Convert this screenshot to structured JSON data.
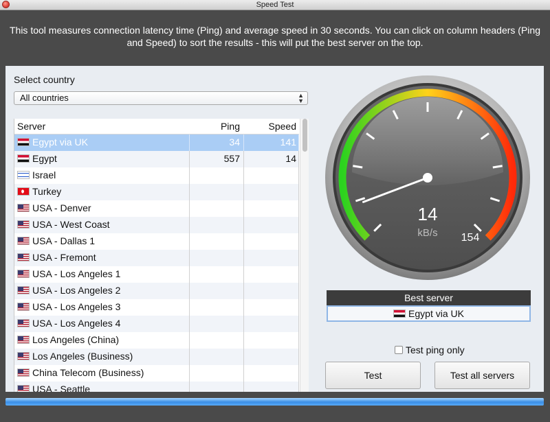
{
  "window": {
    "title": "Speed Test"
  },
  "description": "This tool measures connection latency time (Ping) and average speed in 30 seconds. You can click on column headers (Ping and Speed) to sort the results - this will put the best server on the top.",
  "country": {
    "label": "Select country",
    "selected": "All countries"
  },
  "table": {
    "headers": {
      "server": "Server",
      "ping": "Ping",
      "speed": "Speed"
    },
    "rows": [
      {
        "server": "Egypt via UK",
        "flag": "eg",
        "ping": "34",
        "speed": "141",
        "selected": true
      },
      {
        "server": "Egypt",
        "flag": "eg",
        "ping": "557",
        "speed": "14"
      },
      {
        "server": "Israel",
        "flag": "il",
        "ping": "",
        "speed": ""
      },
      {
        "server": "Turkey",
        "flag": "tr",
        "ping": "",
        "speed": ""
      },
      {
        "server": "USA - Denver",
        "flag": "us",
        "ping": "",
        "speed": ""
      },
      {
        "server": "USA - West Coast",
        "flag": "us",
        "ping": "",
        "speed": ""
      },
      {
        "server": "USA - Dallas 1",
        "flag": "us",
        "ping": "",
        "speed": ""
      },
      {
        "server": "USA - Fremont",
        "flag": "us",
        "ping": "",
        "speed": ""
      },
      {
        "server": "USA - Los Angeles 1",
        "flag": "us",
        "ping": "",
        "speed": ""
      },
      {
        "server": "USA - Los Angeles 2",
        "flag": "us",
        "ping": "",
        "speed": ""
      },
      {
        "server": "USA - Los Angeles 3",
        "flag": "us",
        "ping": "",
        "speed": ""
      },
      {
        "server": "USA - Los Angeles 4",
        "flag": "us",
        "ping": "",
        "speed": ""
      },
      {
        "server": "Los Angeles (China)",
        "flag": "us",
        "ping": "",
        "speed": ""
      },
      {
        "server": "Los Angeles (Business)",
        "flag": "us",
        "ping": "",
        "speed": ""
      },
      {
        "server": "China Telecom (Business)",
        "flag": "us",
        "ping": "",
        "speed": ""
      },
      {
        "server": "USA - Seattle",
        "flag": "us",
        "ping": "",
        "speed": ""
      }
    ]
  },
  "gauge": {
    "value": "14",
    "unit": "kB/s",
    "max_label": "154",
    "needle_fraction": 0.09,
    "colors": {
      "low": "#2bd21f",
      "mid": "#ffd21a",
      "high": "#ff2a0a",
      "face": "#5d5d5d"
    }
  },
  "best_server": {
    "header": "Best server",
    "value": "Egypt via UK",
    "flag": "eg"
  },
  "options": {
    "ping_only_label": "Test ping only",
    "ping_only_checked": false
  },
  "buttons": {
    "test": "Test",
    "test_all": "Test all servers"
  },
  "progress": {
    "fraction": 1.0,
    "color": "#3a8ee6"
  },
  "icons": {
    "close": "close-icon",
    "select_arrows": "updown-arrows-icon",
    "checkbox": "checkbox-icon"
  }
}
